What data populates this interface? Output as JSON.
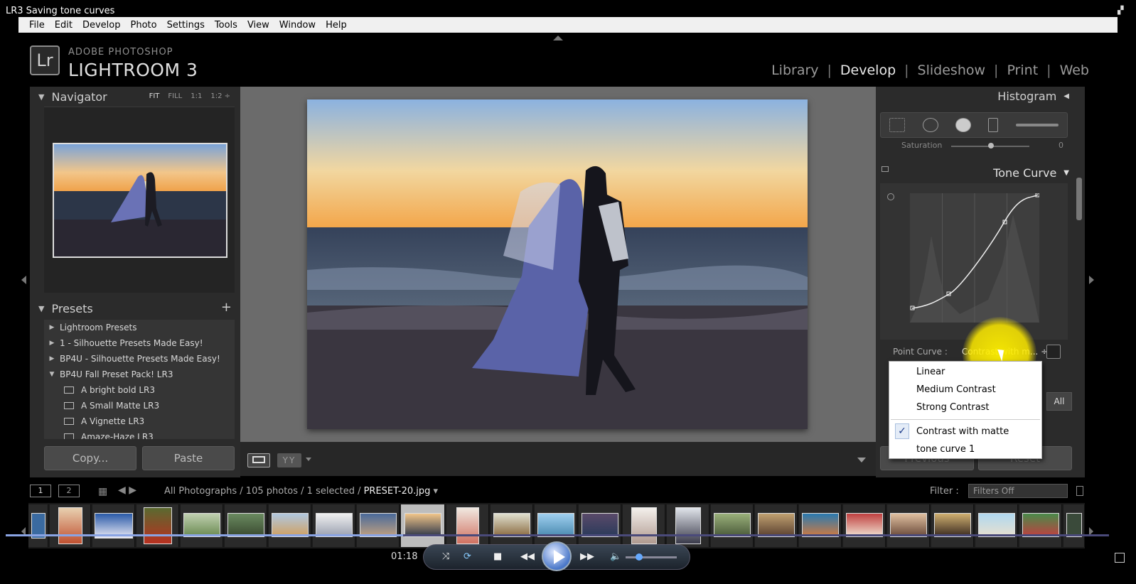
{
  "window": {
    "title": "LR3 Saving tone curves"
  },
  "menu": [
    "File",
    "Edit",
    "Develop",
    "Photo",
    "Settings",
    "Tools",
    "View",
    "Window",
    "Help"
  ],
  "brand": {
    "logo": "Lr",
    "line1": "ADOBE PHOTOSHOP",
    "line2": "LIGHTROOM 3"
  },
  "modules": {
    "library": "Library",
    "develop": "Develop",
    "slideshow": "Slideshow",
    "print": "Print",
    "web": "Web",
    "sep": "|"
  },
  "navigator": {
    "title": "Navigator",
    "fit": "FIT",
    "fill": "FILL",
    "one": "1:1",
    "ratio": "1:2 ÷"
  },
  "presets": {
    "title": "Presets",
    "add": "+",
    "items": [
      {
        "label": "Lightroom Presets",
        "expanded": false
      },
      {
        "label": "1 - Silhouette Presets Made Easy!",
        "expanded": false
      },
      {
        "label": "BP4U - Silhouette Presets Made Easy!",
        "expanded": false
      },
      {
        "label": "BP4U Fall Preset Pack! LR3",
        "expanded": true
      }
    ],
    "children": [
      "A bright bold LR3",
      "A Small Matte LR3",
      "A Vignette LR3",
      "Amaze-Haze LR3"
    ]
  },
  "left_buttons": {
    "copy": "Copy...",
    "paste": "Paste"
  },
  "toolbar": {
    "yy": "YY"
  },
  "right": {
    "histogram": "Histogram",
    "saturation_label": "Saturation",
    "saturation_value": "0",
    "tone_curve": "Tone Curve",
    "point_curve_label": "Point Curve :",
    "point_curve_value": "Contrast with m... ÷",
    "all": "All",
    "previous": "Previous",
    "reset": "Reset"
  },
  "dropdown": {
    "items": [
      "Linear",
      "Medium Contrast",
      "Strong Contrast"
    ],
    "checked": "Contrast with matte",
    "check_mark": "✓",
    "extra": "tone curve 1"
  },
  "filmstrip": {
    "page1": "1",
    "page2": "2",
    "path": "All Photographs / 105 photos / 1 selected /",
    "file": "PRESET-20.jpg",
    "filter_label": "Filter :",
    "filter_value": "Filters Off"
  },
  "player": {
    "time": "01:18",
    "progress": 0.36,
    "volume": 0.2
  },
  "colors": {
    "panel": "#2b2b2b",
    "center": "#6b6b6b",
    "accent": "#ffeb00"
  }
}
